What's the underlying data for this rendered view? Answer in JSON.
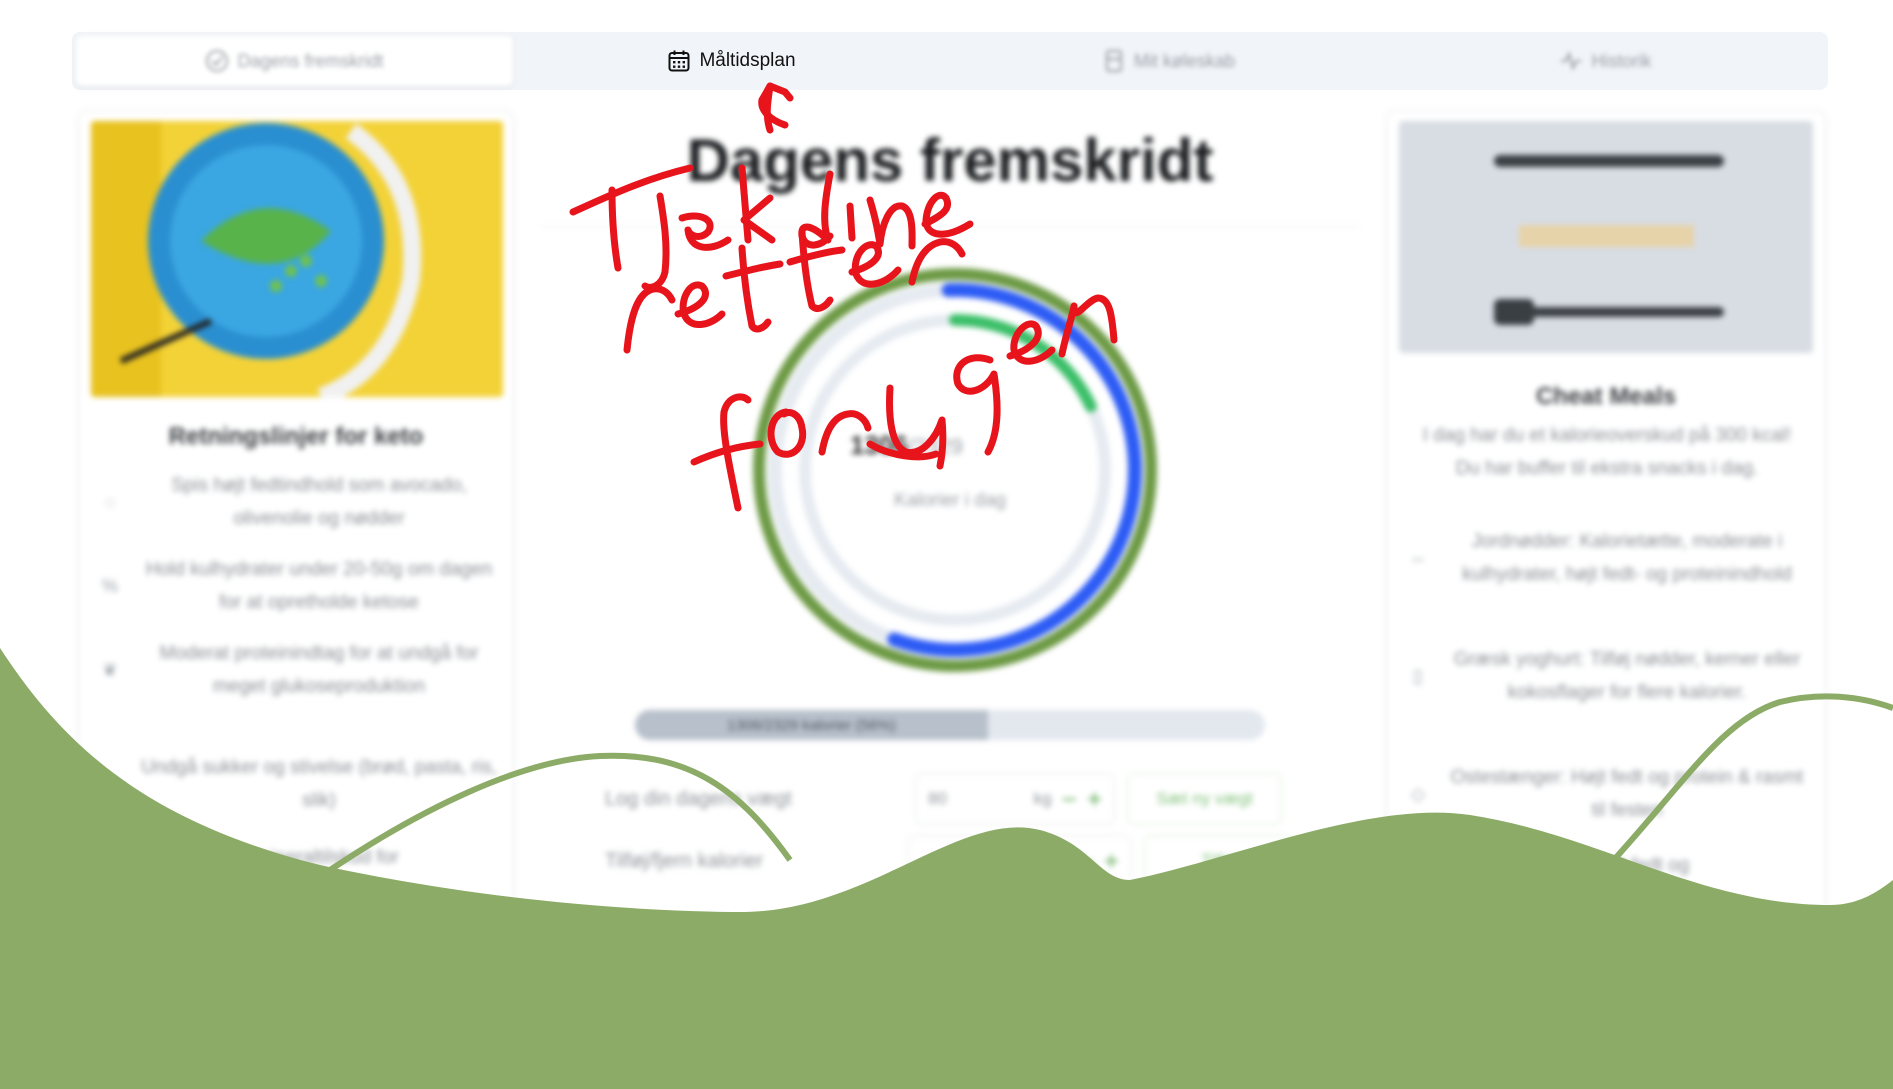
{
  "tabs": [
    {
      "label": "Dagens fremskridt",
      "icon": "check-circle-icon"
    },
    {
      "label": "Måltidsplan",
      "icon": "calendar-icon"
    },
    {
      "label": "Mit køleskab",
      "icon": "fridge-icon"
    },
    {
      "label": "Historik",
      "icon": "activity-icon"
    }
  ],
  "left_card": {
    "image": "keto-plate-image",
    "title": "Retningslinjer for keto",
    "rules": [
      {
        "icon": "drop-icon",
        "text": "Spis højt fedtindhold som avocado, olivenolie og nødder"
      },
      {
        "icon": "percent-icon",
        "text": "Hold kulhydrater under 20-50g om dagen for at opretholde ketose"
      },
      {
        "icon": "leaf-icon",
        "text": "Moderat proteinindtag for at undgå for meget glukoseproduktion"
      },
      {
        "icon": "ban-icon",
        "text": "Undgå sukker og stivelse (brød, pasta, ris, slik)"
      },
      {
        "icon": "info-icon",
        "text": "...mineraltilskud for"
      }
    ]
  },
  "main": {
    "title": "Dagens fremskridt",
    "ring": {
      "value": "1306",
      "goal": "/2329",
      "label": "Kalorier i dag"
    },
    "progress": {
      "label": "1306/2329 kalorier (56%)",
      "fraction": 0.56
    },
    "weight": {
      "label": "Log din dagens vægt",
      "value": "80",
      "unit": "kg",
      "button": "Sæt ny vægt"
    },
    "calories": {
      "label": "Tilføj/fjern kalorier",
      "button": "Tilføj"
    }
  },
  "right_card": {
    "image": "keto-diet-cutlery-image",
    "title": "Cheat Meals",
    "intro": "I dag har du et kalorieoverskud på 300 kcal! Du har buffer til ekstra snacks i dag.",
    "items": [
      {
        "icon": "nut-icon",
        "text": "Jordnødder: Kalorietætte, moderate i kulhydrater, højt fedt- og proteinindhold"
      },
      {
        "icon": "cup-icon",
        "text": "Græsk yoghurt: Tilføj nødder, kerner eller kokosflager for flere kalorier."
      },
      {
        "icon": "cheese-icon",
        "text": "Ostestænger: Højt fedt og protein & rasmt til festen"
      },
      {
        "icon": "egg-icon",
        "text": "...: Højt fedt og"
      }
    ]
  },
  "annotation": {
    "lines": [
      "Tjek dine",
      "retter",
      "for ugen"
    ],
    "color": "#e8141c"
  },
  "colors": {
    "accent_green": "#5aa84f",
    "ring_blue": "#2d5cf5",
    "wave_green": "#8cab67"
  }
}
